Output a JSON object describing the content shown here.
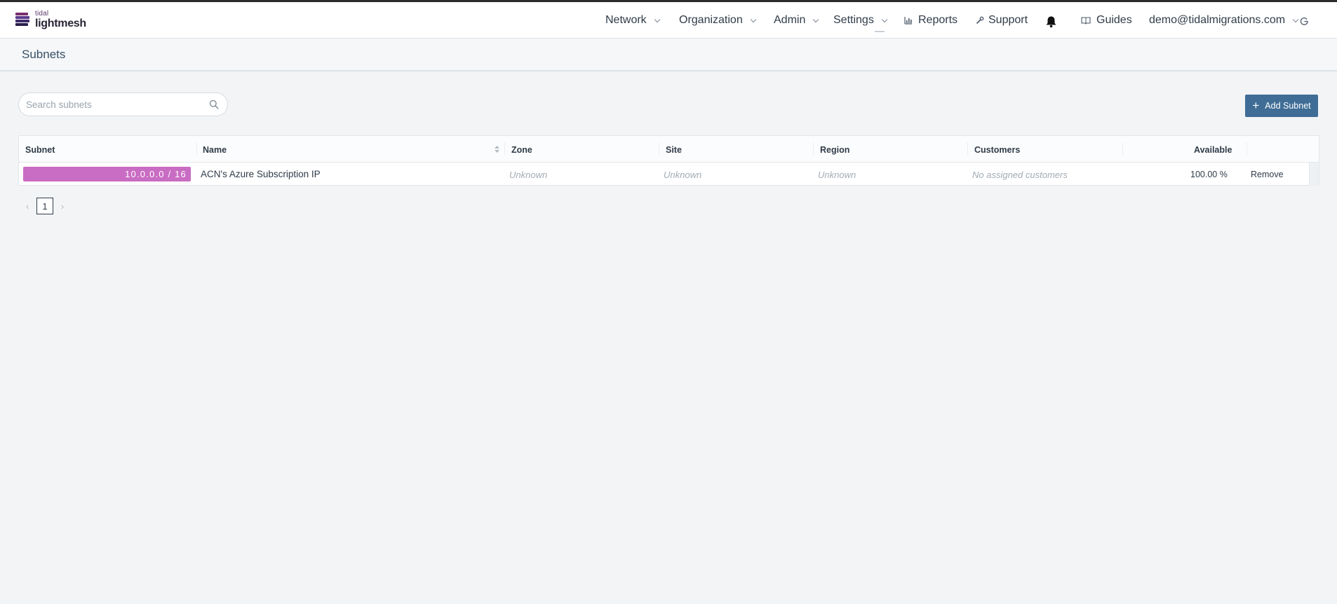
{
  "brand": {
    "small": "tidal",
    "big": "lightmesh"
  },
  "nav": {
    "network": "Network",
    "organization": "Organization",
    "admin": "Admin",
    "settings": "Settings",
    "reports": "Reports",
    "support": "Support",
    "guides": "Guides",
    "user": "demo@tidalmigrations.com"
  },
  "page": {
    "title": "Subnets"
  },
  "search": {
    "placeholder": "Search subnets",
    "value": ""
  },
  "actions": {
    "add_subnet": "Add Subnet"
  },
  "table": {
    "columns": [
      "Subnet",
      "Name",
      "Zone",
      "Site",
      "Region",
      "Customers",
      "Available"
    ],
    "rows": [
      {
        "subnet": "10.0.0.0 / 16",
        "name": "ACN's Azure Subscription IP",
        "zone": "Unknown",
        "site": "Unknown",
        "region": "Unknown",
        "customers": "No assigned customers",
        "available": "100.00 %",
        "action": "Remove"
      }
    ]
  },
  "pagination": {
    "current_page": "1"
  },
  "colors": {
    "subnet_bar": "#c96cc3",
    "primary_button": "#3f6d96",
    "top_border": "#2b2b2b"
  }
}
